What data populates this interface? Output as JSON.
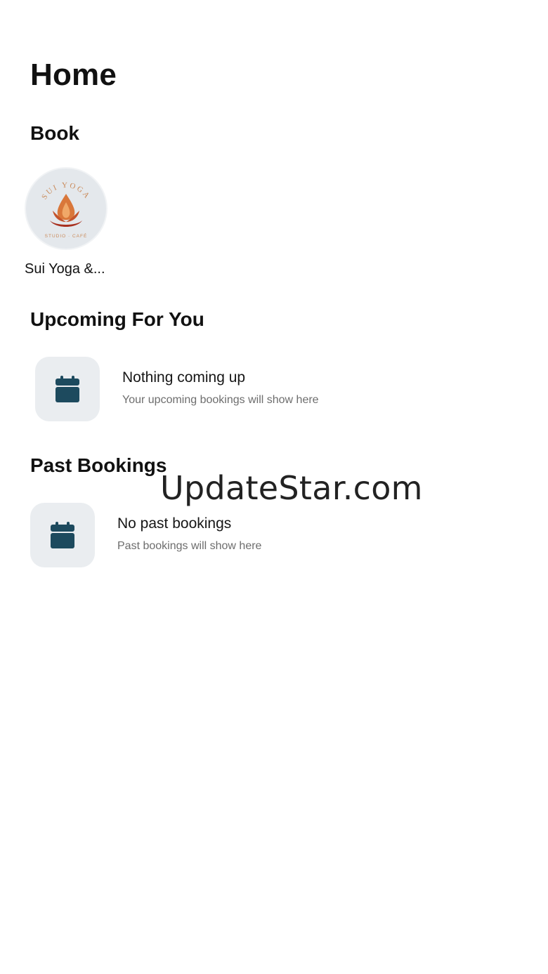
{
  "header": {
    "title": "Home"
  },
  "book": {
    "heading": "Book",
    "studios": [
      {
        "name": "Sui Yoga &...",
        "logo_text_top": "SUI YOGA",
        "logo_text_bottom": "STUDIO · CAFÉ",
        "icon": "lotus-logo-icon"
      }
    ]
  },
  "upcoming": {
    "heading": "Upcoming For You",
    "empty_title": "Nothing coming up",
    "empty_subtitle": "Your upcoming bookings will show here",
    "icon": "calendar-icon"
  },
  "past": {
    "heading": "Past Bookings",
    "empty_title": "No past bookings",
    "empty_subtitle": "Past bookings will show here",
    "icon": "calendar-icon"
  },
  "watermark": "UpdateStar.com",
  "colors": {
    "accent": "#1d4a5e",
    "tile_bg": "#eaedf0",
    "logo_orange": "#d9773a",
    "logo_red": "#a8301f"
  }
}
